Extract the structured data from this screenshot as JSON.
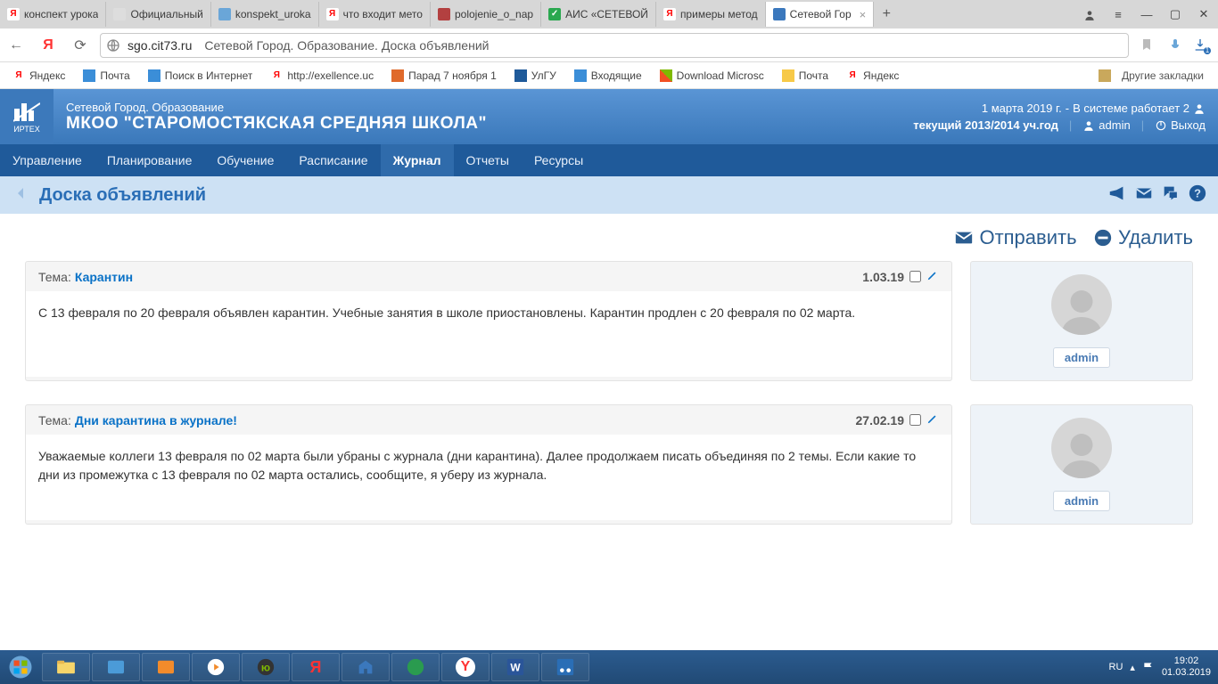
{
  "browser": {
    "tabs": [
      {
        "label": "конспект урока",
        "favcolor": "#ff0000",
        "favText": "Я"
      },
      {
        "label": "Официальный",
        "favcolor": "#aaaaaa",
        "favText": ""
      },
      {
        "label": "konspekt_uroka",
        "favcolor": "#6aa6d8",
        "favText": ""
      },
      {
        "label": "что входит мето",
        "favcolor": "#ff0000",
        "favText": "Я"
      },
      {
        "label": "polojenie_o_nap",
        "favcolor": "#b34040",
        "favText": ""
      },
      {
        "label": "АИС «СЕТЕВОЙ",
        "favcolor": "#2aa84f",
        "favText": "✓"
      },
      {
        "label": "примеры метод",
        "favcolor": "#ff0000",
        "favText": "Я"
      },
      {
        "label": "Сетевой Гор",
        "favcolor": "#3b78bd",
        "favText": "",
        "active": true,
        "closable": true
      }
    ],
    "addr": {
      "host": "sgo.cit73.ru",
      "title": "Сетевой Город. Образование. Доска объявлений"
    },
    "bookmarks": [
      {
        "label": "Яндекс"
      },
      {
        "label": "Почта"
      },
      {
        "label": "Поиск в Интернет"
      },
      {
        "label": "http://exellence.uc"
      },
      {
        "label": "Парад 7 ноября 1"
      },
      {
        "label": "УлГУ"
      },
      {
        "label": "Входящие"
      },
      {
        "label": "Download Microsc"
      },
      {
        "label": "Почта"
      },
      {
        "label": "Яндекс"
      }
    ],
    "more_bookmarks": "Другие закладки"
  },
  "app": {
    "logo_caption": "ИРТЕХ",
    "subtitle": "Сетевой Город. Образование",
    "title": "МКОО \"СТАРОМОСТЯКСКАЯ СРЕДНЯЯ ШКОЛА\"",
    "status": {
      "date": "1 марта 2019 г.",
      "sep": " - ",
      "text": "В системе работает 2"
    },
    "year_label": "текущий 2013/2014 уч.год",
    "user": "admin",
    "logout": "Выход"
  },
  "nav": {
    "items": [
      "Управление",
      "Планирование",
      "Обучение",
      "Расписание",
      "Журнал",
      "Отчеты",
      "Ресурсы"
    ],
    "active_index": 4
  },
  "page": {
    "title": "Доска объявлений"
  },
  "actions": {
    "send": "Отправить",
    "delete": "Удалить"
  },
  "posts": [
    {
      "subject_label": "Тема:",
      "topic": "Карантин",
      "date": "1.03.19",
      "body": "С 13 февраля по 20 февраля объявлен карантин. Учебные занятия в школе приостановлены. Карантин продлен с 20 февраля по 02 марта.",
      "author": "admin"
    },
    {
      "subject_label": "Тема:",
      "topic": "Дни карантина в журнале!",
      "date": "27.02.19",
      "body": "Уважаемые коллеги  13 февраля по 02 марта были убраны  с журнала (дни карантина). Далее продолжаем писать объединяя по 2 темы. Если какие то дни из промежутка с 13 февраля по 02 марта остались, сообщите, я уберу из журнала.",
      "author": "admin"
    }
  ],
  "taskbar": {
    "lang": "RU",
    "time": "19:02",
    "date": "01.03.2019"
  }
}
